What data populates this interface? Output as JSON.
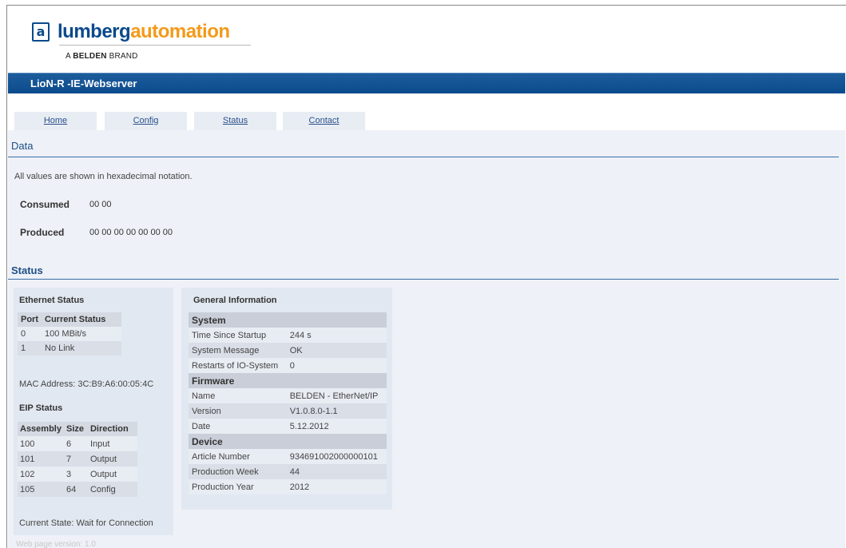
{
  "header": {
    "logo_mark": "a",
    "logo_word1": "lumberg",
    "logo_word2": "automation",
    "brand_prefix": "A ",
    "brand_bold": "BELDEN",
    "brand_suffix": " BRAND"
  },
  "titlebar": {
    "title": "LioN-R -IE-Webserver"
  },
  "tabs": [
    {
      "label": "Home"
    },
    {
      "label": "Config"
    },
    {
      "label": "Status"
    },
    {
      "label": "Contact"
    }
  ],
  "data_section": {
    "title": "Data",
    "note": "All values are shown in hexadecimal notation.",
    "consumed_label": "Consumed",
    "consumed_value": "00 00",
    "produced_label": "Produced",
    "produced_value": "00 00 00 00 00 00 00"
  },
  "status_section": {
    "title": "Status",
    "ethernet": {
      "title": "Ethernet Status",
      "headers": [
        "Port",
        "Current Status"
      ],
      "rows": [
        [
          "0",
          "100 MBit/s"
        ],
        [
          "1",
          "No Link"
        ]
      ],
      "mac": "MAC Address: 3C:B9:A6:00:05:4C"
    },
    "eip": {
      "title": "EIP Status",
      "headers": [
        "Assembly",
        "Size",
        "Direction"
      ],
      "rows": [
        [
          "100",
          "6",
          "Input"
        ],
        [
          "101",
          "7",
          "Output"
        ],
        [
          "102",
          "3",
          "Output"
        ],
        [
          "105",
          "64",
          "Config"
        ]
      ],
      "current_state": "Current State: Wait for Connection"
    },
    "general": {
      "title": "General Information",
      "system_header": "System",
      "system_rows": [
        [
          "Time Since Startup",
          "244 s"
        ],
        [
          "System Message",
          "OK"
        ],
        [
          "Restarts of IO-System",
          "0"
        ]
      ],
      "firmware_header": "Firmware",
      "firmware_rows": [
        [
          "Name",
          "BELDEN - EtherNet/IP"
        ],
        [
          "Version",
          "V1.0.8.0-1.1"
        ],
        [
          "Date",
          "5.12.2012"
        ]
      ],
      "device_header": "Device",
      "device_rows": [
        [
          "Article Number",
          "934691002000000101"
        ],
        [
          "Production Week",
          "44"
        ],
        [
          "Production Year",
          "2012"
        ]
      ]
    }
  },
  "footer": {
    "version": "Web page version: 1.0"
  },
  "colors": {
    "brand_blue": "#0b4a8c",
    "brand_orange": "#f39a1a",
    "panel_bg": "#eef1f7"
  }
}
